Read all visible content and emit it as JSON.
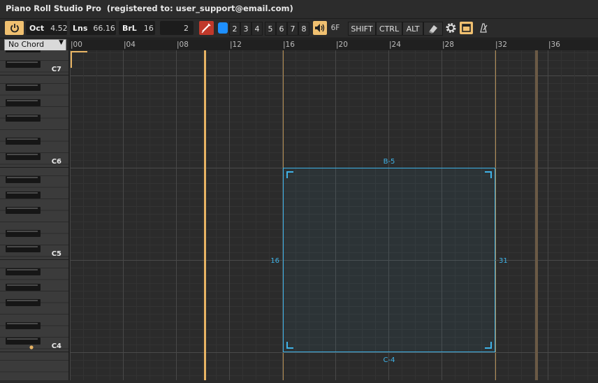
{
  "window": {
    "title": "Piano Roll Studio Pro  (registered to: user_support@email.com)"
  },
  "toolbar": {
    "oct_label": "Oct",
    "oct_value": "4.52",
    "lns_label": "Lns",
    "lns_value": "66.16",
    "brl_label": "BrL",
    "brl_value": "16",
    "step_value": "2",
    "layers": [
      "2",
      "3",
      "4",
      "5",
      "6",
      "7",
      "8"
    ],
    "volume_label": "6F",
    "modifiers": {
      "shift": "SHIFT",
      "ctrl": "CTRL",
      "alt": "ALT"
    }
  },
  "chord_select": {
    "value": "No Chord"
  },
  "piano": {
    "labels": [
      "C7",
      "C6",
      "C5",
      "C4"
    ]
  },
  "ruler": {
    "ticks": [
      "|00",
      "|04",
      "|08",
      "|12",
      "|16",
      "|20",
      "|24",
      "|28",
      "|32",
      "|36"
    ]
  },
  "selection": {
    "top_note": "B-5",
    "bottom_note": "C-4",
    "start_step": "16",
    "end_step": "31"
  },
  "colors": {
    "accent": "#f0c070",
    "selection": "#3fb3e8",
    "active_layer": "#1e90ff"
  }
}
